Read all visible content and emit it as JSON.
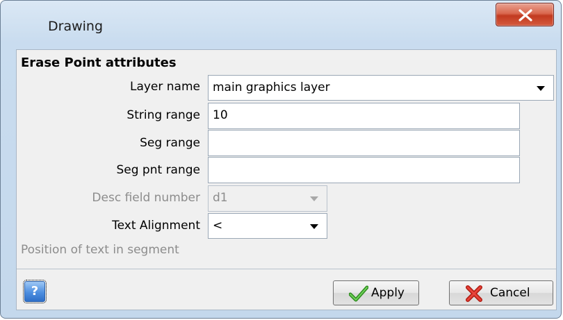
{
  "window": {
    "title": "Drawing",
    "close_label": "X"
  },
  "form": {
    "section_title": "Erase Point attributes",
    "layer_name": {
      "label": "Layer name",
      "value": "main graphics layer"
    },
    "string_range": {
      "label": "String range",
      "value": "10"
    },
    "seg_range": {
      "label": "Seg range",
      "value": ""
    },
    "seg_pnt_range": {
      "label": "Seg pnt range",
      "value": ""
    },
    "desc_field_number": {
      "label": "Desc field number",
      "value": "d1",
      "disabled": true
    },
    "text_alignment": {
      "label": "Text Alignment",
      "value": "<"
    },
    "position_hint": "Position of text in segment"
  },
  "footer": {
    "help_label": "?",
    "apply_label": "Apply",
    "cancel_label": "Cancel"
  },
  "colors": {
    "title_bar": "#c9dcef",
    "close_button": "#c23a20",
    "apply_check": "#3a9a2a",
    "cancel_x": "#d0281c",
    "help_icon": "#4d8ee0"
  },
  "icons": {
    "close": "close-icon",
    "dropdown": "chevron-down-icon",
    "help": "help-icon",
    "apply": "checkmark-icon",
    "cancel": "red-x-icon"
  }
}
